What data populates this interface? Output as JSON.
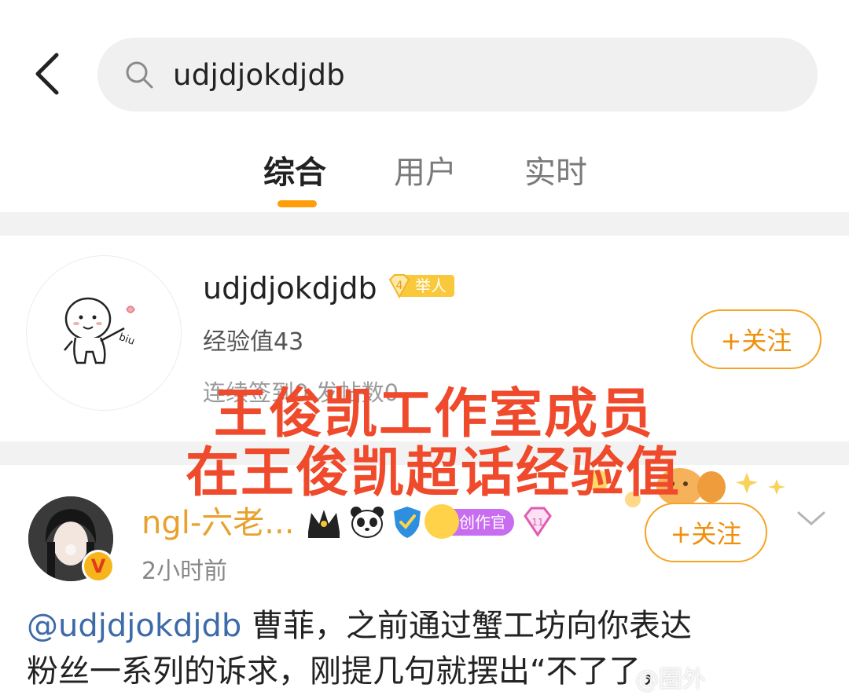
{
  "search": {
    "query": "udjdjokdjdb"
  },
  "tabs": [
    {
      "label": "综合",
      "active": true
    },
    {
      "label": "用户",
      "active": false
    },
    {
      "label": "实时",
      "active": false
    }
  ],
  "user_card": {
    "name": "udjdjokdjdb",
    "level_number": "4",
    "level_label": "举人",
    "exp": "经验值43",
    "stats": "连续签到0 发帖数0",
    "follow_label": "+关注"
  },
  "overlay": {
    "line1": "王俊凯工作室成员",
    "line2": "在王俊凯超话经验值"
  },
  "post": {
    "author": "ngl-六老...",
    "vip_letter": "V",
    "creator_badge": "创作官",
    "time": "2小时前",
    "follow_label": "+关注",
    "mention": "@udjdjokdjdb",
    "text_line1": " 曹菲，之前通过蟹工坊向你表达",
    "text_line2": "粉丝一系列的诉求，刚提几句就摆出“不了了，"
  },
  "watermark": "@圈外",
  "colors": {
    "accent": "#ff9d0a",
    "follow": "#ef8f0a",
    "overlay_red": "#ef4a2b",
    "mention_blue": "#3d6aa8"
  }
}
